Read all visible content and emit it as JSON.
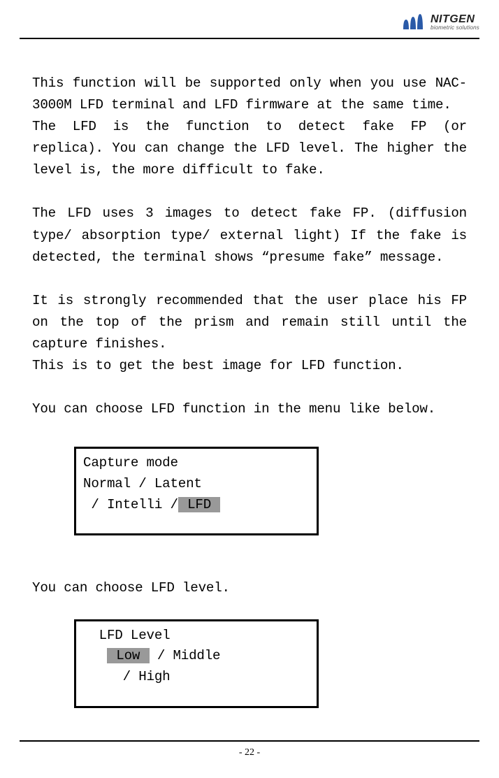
{
  "brand": {
    "name": "NITGEN",
    "tagline": "biometric solutions"
  },
  "body": {
    "p1": "This function will be supported only when you use NAC-3000M LFD terminal and LFD firmware at the same time.",
    "p2": "The LFD is the function to detect fake FP (or replica). You can change the LFD level. The higher the level is, the more difficult to fake.",
    "p3": "The LFD uses 3 images to detect fake FP. (diffusion type/ absorption type/ external light) If the fake is detected, the terminal shows “presume fake” message.",
    "p4": "It is strongly recommended that the user place his FP on the top of the prism and remain still until the capture finishes.",
    "p5": "This is to get the best image for LFD function.",
    "p6": "You can choose LFD function in the menu like below.",
    "p7": "You can choose LFD level."
  },
  "menu_capture": {
    "title": "Capture mode",
    "line2_a": "Normal / Latent",
    "line3_a": " / Intelli /",
    "line3_hl": " LFD "
  },
  "menu_level": {
    "title": "  LFD Level",
    "line2_pre": "   ",
    "line2_hl": " Low ",
    "line2_post": "/ Middle",
    "line3": "     / High"
  },
  "page": "- 22 -"
}
